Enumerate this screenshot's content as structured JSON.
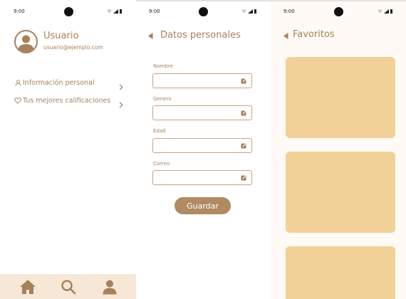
{
  "status_bar": {
    "time": "9:00"
  },
  "profile_screen": {
    "user_name": "Usuario",
    "user_email": "usuario@ejemplo.com",
    "menu": [
      {
        "label": "Información personal",
        "icon": "user-icon"
      },
      {
        "label": "Tus mejores calificaciones",
        "icon": "heart-icon"
      }
    ],
    "bottom_nav": [
      {
        "icon": "home-icon"
      },
      {
        "icon": "search-icon"
      },
      {
        "icon": "profile-icon"
      }
    ]
  },
  "personal_data_screen": {
    "title": "Datos personales",
    "fields": [
      {
        "label": "Nombre",
        "value": ""
      },
      {
        "label": "Genero",
        "value": ""
      },
      {
        "label": "Edad",
        "value": ""
      },
      {
        "label": "Correo",
        "value": ""
      }
    ],
    "save_label": "Guardar"
  },
  "favorites_screen": {
    "title": "Favoritos",
    "card_count": 3
  },
  "colors": {
    "accent": "#a8805a",
    "button": "#b08a63",
    "card": "#f2d198",
    "nav_background": "#f6e7d6",
    "field_border": "#c4a383"
  }
}
